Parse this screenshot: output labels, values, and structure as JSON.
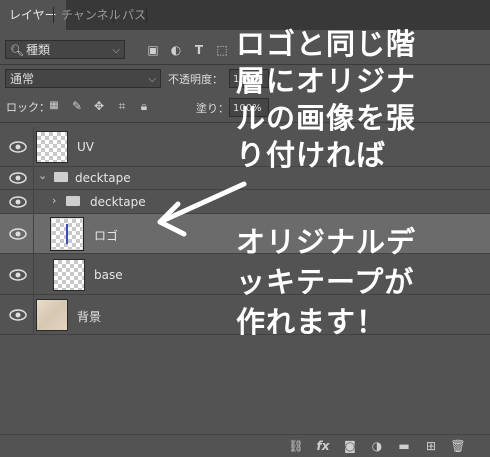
{
  "tabs": [
    "レイヤー",
    "チャンネル",
    "パス"
  ],
  "filter": {
    "label": "種類",
    "icons": [
      "image-filter-icon",
      "adjustment-filter-icon",
      "type-filter-icon",
      "shape-filter-icon",
      "smart-object-filter-icon"
    ]
  },
  "blend": {
    "mode": "通常",
    "opacity_label": "不透明度：",
    "opacity_value": "100%"
  },
  "lock": {
    "label": "ロック：",
    "fill_label": "塗り：",
    "fill_value": "100%"
  },
  "layers": [
    {
      "name": "UV"
    },
    {
      "name": "decktape"
    },
    {
      "name": "decktape"
    },
    {
      "name": "ロゴ"
    },
    {
      "name": "base"
    },
    {
      "name": "背景"
    }
  ],
  "annotation_top": [
    "ロゴと同じ階",
    "層にオリジナ",
    "ルの画像を張",
    "り付ければ"
  ],
  "annotation_bottom": [
    "オリジナルデ",
    "ッキテープが",
    "作れます！"
  ],
  "bottom_icons": [
    "link-icon",
    "fx-icon",
    "mask-icon",
    "adjustment-icon",
    "folder-icon",
    "new-layer-icon",
    "trash-icon"
  ]
}
